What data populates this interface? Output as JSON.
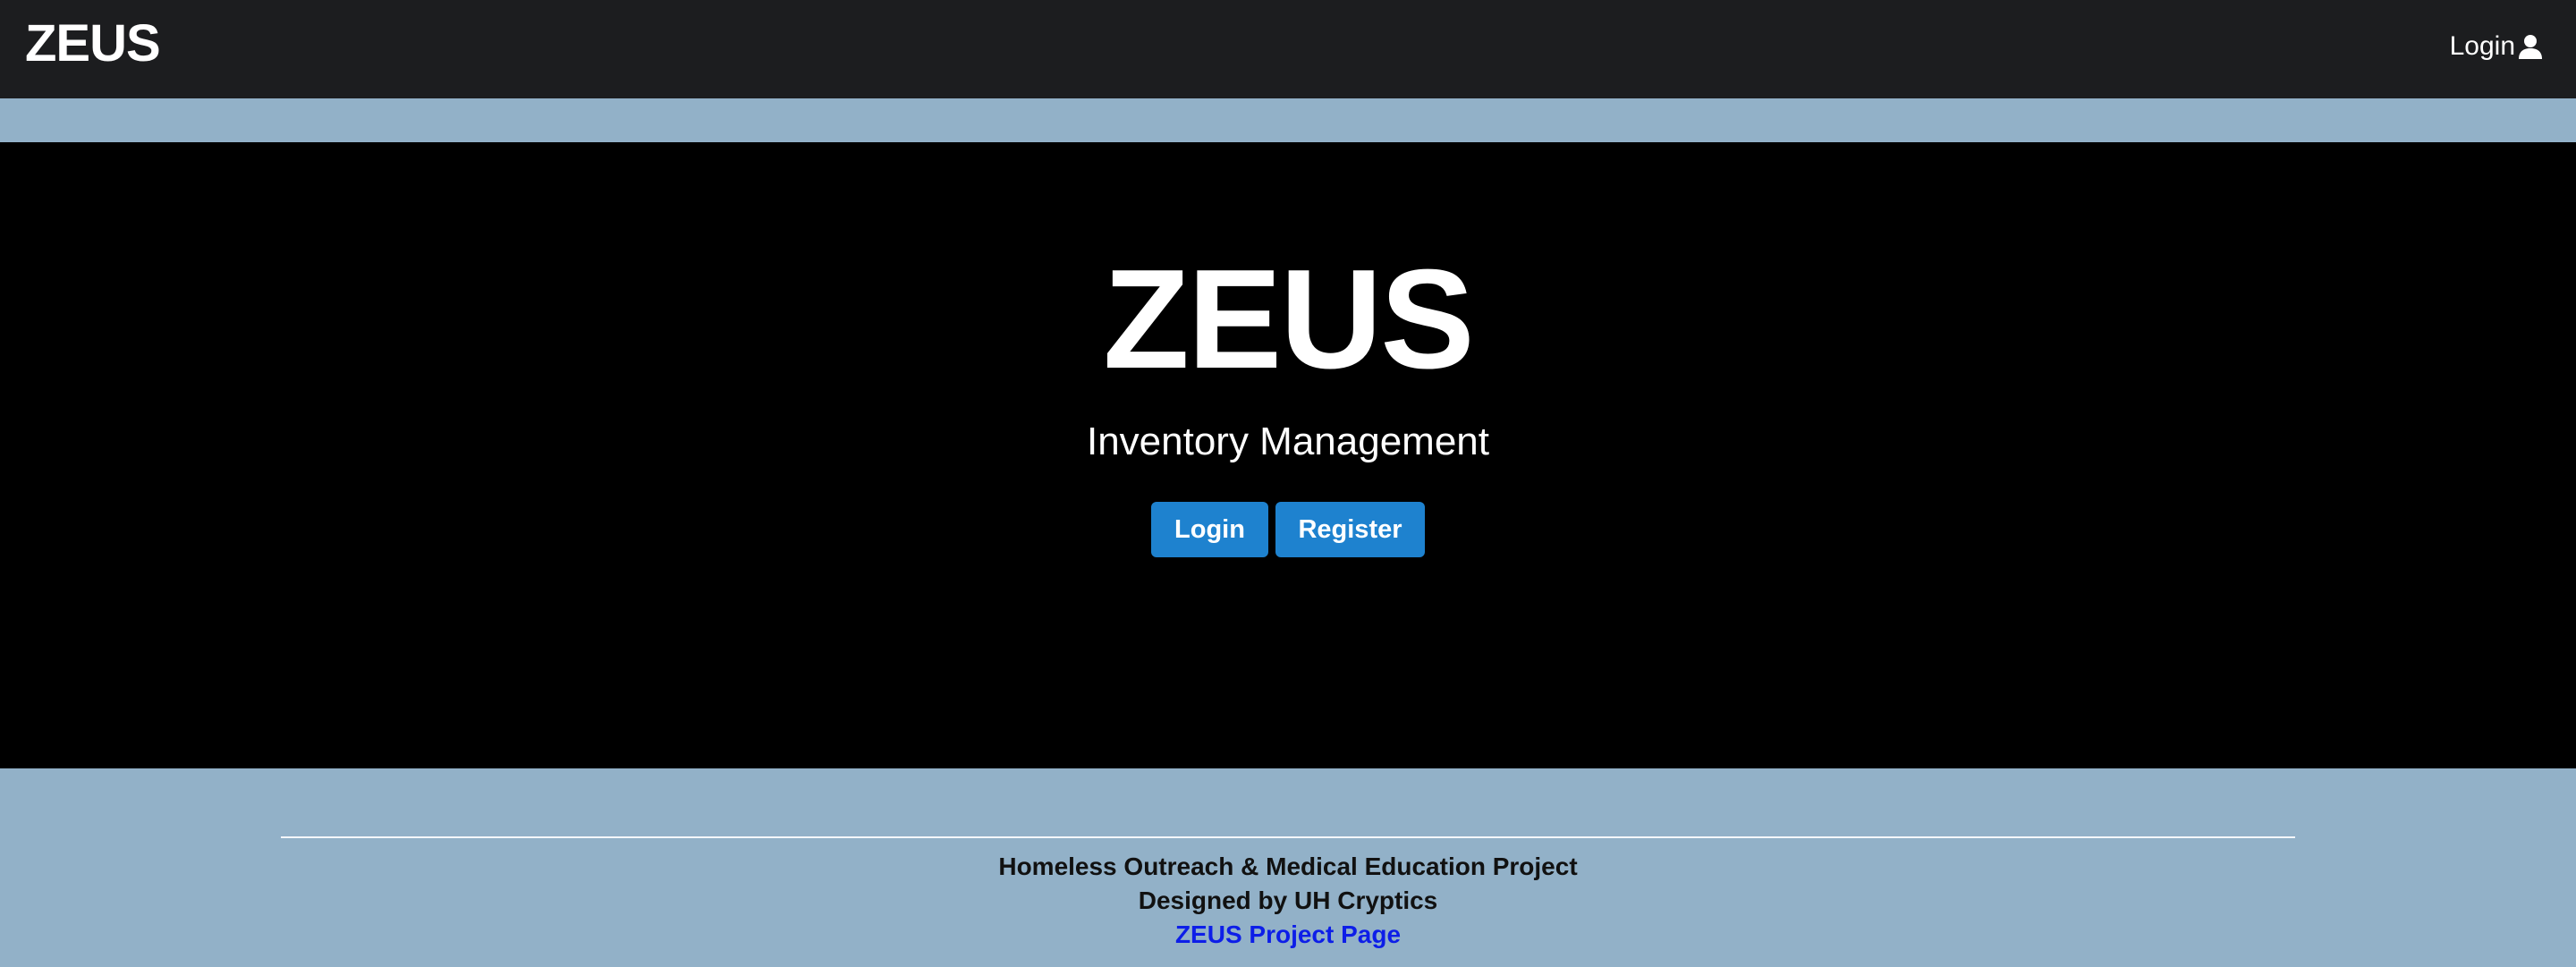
{
  "navbar": {
    "brand": "ZEUS",
    "login_label": "Login",
    "login_icon": "user-icon"
  },
  "hero": {
    "title": "ZEUS",
    "subtitle": "Inventory Management",
    "login_button": "Login",
    "register_button": "Register"
  },
  "footer": {
    "line1": "Homeless Outreach & Medical Education Project",
    "line2": "Designed by UH Cryptics",
    "link_label": "ZEUS Project Page"
  },
  "colors": {
    "navbar_bg": "#1c1d1f",
    "page_bg": "#92b1c8",
    "hero_bg": "#000000",
    "button_bg": "#1e82cf",
    "link": "#0d1ee8"
  }
}
